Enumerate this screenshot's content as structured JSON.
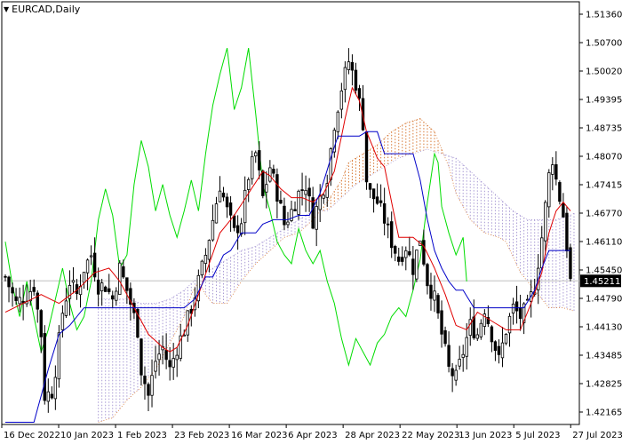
{
  "title": {
    "symbol_timeframe": "EURCAD,Daily",
    "icon": "dropdown-triangle-icon"
  },
  "colors": {
    "background": "#ffffff",
    "axis": "#000000",
    "grid_line": "#c0c0c0",
    "tenkan": "#e00000",
    "kijun": "#0000c8",
    "chikou": "#00dd00",
    "senkou_a_cloud": "#d2691e",
    "senkou_b_cloud": "#a090d0",
    "candle_bull": "#000000",
    "candle_bear": "#000000",
    "price_tag_bg": "#000000",
    "price_tag_text": "#ffffff"
  },
  "chart_data": {
    "type": "candlestick",
    "indicator": "Ichimoku Kinko Hyo",
    "symbol": "EURCAD",
    "timeframe": "Daily",
    "ylim": [
      1.4195,
      1.5155
    ],
    "y_ticks": [
      "1.51360",
      "1.50700",
      "1.50020",
      "1.49395",
      "1.48735",
      "1.48070",
      "1.47415",
      "1.46770",
      "1.46110",
      "1.45450",
      "1.44790",
      "1.44130",
      "1.43485",
      "1.42825",
      "1.42165"
    ],
    "x_tick_labels": [
      "16 Dec 2022",
      "10 Jan 2023",
      "1 Feb 2023",
      "23 Feb 2023",
      "16 Mar 2023",
      "6 Apr 2023",
      "28 Apr 2023",
      "22 May 2023",
      "13 Jun 2023",
      "5 Jul 2023",
      "27 Jul 2023"
    ],
    "current_price": "1.45211",
    "current_price_value": 1.45211,
    "close_keys": [
      [
        0,
        1.453
      ],
      [
        3,
        1.447
      ],
      [
        6,
        1.449
      ],
      [
        8,
        1.451
      ],
      [
        10,
        1.44
      ],
      [
        11,
        1.426
      ],
      [
        13,
        1.427
      ],
      [
        14,
        1.432
      ],
      [
        16,
        1.445
      ],
      [
        18,
        1.452
      ],
      [
        20,
        1.449
      ],
      [
        22,
        1.455
      ],
      [
        24,
        1.458
      ],
      [
        26,
        1.451
      ],
      [
        28,
        1.451
      ],
      [
        30,
        1.448
      ],
      [
        32,
        1.455
      ],
      [
        34,
        1.45
      ],
      [
        36,
        1.444
      ],
      [
        37,
        1.441
      ],
      [
        38,
        1.432
      ],
      [
        40,
        1.426
      ],
      [
        42,
        1.434
      ],
      [
        44,
        1.437
      ],
      [
        46,
        1.432
      ],
      [
        48,
        1.437
      ],
      [
        50,
        1.441
      ],
      [
        52,
        1.446
      ],
      [
        54,
        1.452
      ],
      [
        56,
        1.458
      ],
      [
        58,
        1.466
      ],
      [
        60,
        1.474
      ],
      [
        62,
        1.468
      ],
      [
        64,
        1.463
      ],
      [
        66,
        1.466
      ],
      [
        68,
        1.476
      ],
      [
        70,
        1.481
      ],
      [
        71,
        1.476
      ],
      [
        72,
        1.471
      ],
      [
        74,
        1.478
      ],
      [
        76,
        1.472
      ],
      [
        78,
        1.465
      ],
      [
        80,
        1.468
      ],
      [
        82,
        1.472
      ],
      [
        84,
        1.474
      ],
      [
        86,
        1.466
      ],
      [
        88,
        1.471
      ],
      [
        90,
        1.476
      ],
      [
        92,
        1.488
      ],
      [
        94,
        1.496
      ],
      [
        96,
        1.502
      ],
      [
        98,
        1.497
      ],
      [
        100,
        1.488
      ],
      [
        101,
        1.475
      ],
      [
        102,
        1.472
      ],
      [
        104,
        1.47
      ],
      [
        106,
        1.466
      ],
      [
        108,
        1.461
      ],
      [
        110,
        1.457
      ],
      [
        112,
        1.46
      ],
      [
        114,
        1.455
      ],
      [
        116,
        1.462
      ],
      [
        118,
        1.452
      ],
      [
        120,
        1.448
      ],
      [
        122,
        1.44
      ],
      [
        124,
        1.432
      ],
      [
        126,
        1.43
      ],
      [
        128,
        1.436
      ],
      [
        130,
        1.442
      ],
      [
        132,
        1.44
      ],
      [
        134,
        1.446
      ],
      [
        136,
        1.44
      ],
      [
        138,
        1.434
      ],
      [
        140,
        1.441
      ],
      [
        142,
        1.446
      ],
      [
        144,
        1.444
      ],
      [
        146,
        1.446
      ],
      [
        148,
        1.451
      ],
      [
        150,
        1.462
      ],
      [
        152,
        1.476
      ],
      [
        153,
        1.48
      ],
      [
        154,
        1.475
      ],
      [
        156,
        1.467
      ],
      [
        157,
        1.46
      ],
      [
        158,
        1.452
      ]
    ],
    "tenkan_keys": [
      [
        0,
        1.445
      ],
      [
        5,
        1.447
      ],
      [
        10,
        1.449
      ],
      [
        15,
        1.447
      ],
      [
        20,
        1.45
      ],
      [
        25,
        1.454
      ],
      [
        29,
        1.455
      ],
      [
        32,
        1.452
      ],
      [
        36,
        1.446
      ],
      [
        40,
        1.44
      ],
      [
        44,
        1.437
      ],
      [
        46,
        1.436
      ],
      [
        48,
        1.437
      ],
      [
        51,
        1.442
      ],
      [
        54,
        1.449
      ],
      [
        57,
        1.456
      ],
      [
        60,
        1.463
      ],
      [
        64,
        1.467
      ],
      [
        68,
        1.472
      ],
      [
        72,
        1.477
      ],
      [
        74,
        1.476
      ],
      [
        77,
        1.473
      ],
      [
        80,
        1.471
      ],
      [
        83,
        1.471
      ],
      [
        86,
        1.47
      ],
      [
        89,
        1.472
      ],
      [
        92,
        1.477
      ],
      [
        95,
        1.489
      ],
      [
        97,
        1.496
      ],
      [
        99,
        1.493
      ],
      [
        101,
        1.486
      ],
      [
        104,
        1.48
      ],
      [
        106,
        1.478
      ],
      [
        108,
        1.47
      ],
      [
        110,
        1.462
      ],
      [
        114,
        1.462
      ],
      [
        117,
        1.46
      ],
      [
        120,
        1.455
      ],
      [
        123,
        1.449
      ],
      [
        126,
        1.442
      ],
      [
        129,
        1.441
      ],
      [
        132,
        1.445
      ],
      [
        136,
        1.443
      ],
      [
        140,
        1.441
      ],
      [
        144,
        1.441
      ],
      [
        147,
        1.447
      ],
      [
        150,
        1.454
      ],
      [
        152,
        1.463
      ],
      [
        154,
        1.468
      ],
      [
        156,
        1.47
      ],
      [
        158,
        1.468
      ]
    ],
    "kijun_keys": [
      [
        0,
        1.42
      ],
      [
        5,
        1.42
      ],
      [
        8,
        1.42
      ],
      [
        12,
        1.432
      ],
      [
        15,
        1.44
      ],
      [
        18,
        1.442
      ],
      [
        22,
        1.446
      ],
      [
        24,
        1.446
      ],
      [
        27,
        1.446
      ],
      [
        32,
        1.446
      ],
      [
        36,
        1.446
      ],
      [
        40,
        1.446
      ],
      [
        44,
        1.446
      ],
      [
        47,
        1.446
      ],
      [
        50,
        1.446
      ],
      [
        53,
        1.448
      ],
      [
        56,
        1.453
      ],
      [
        58,
        1.453
      ],
      [
        61,
        1.458
      ],
      [
        63,
        1.459
      ],
      [
        66,
        1.463
      ],
      [
        68,
        1.463
      ],
      [
        70,
        1.463
      ],
      [
        72,
        1.465
      ],
      [
        75,
        1.466
      ],
      [
        79,
        1.466
      ],
      [
        82,
        1.467
      ],
      [
        85,
        1.467
      ],
      [
        88,
        1.472
      ],
      [
        91,
        1.48
      ],
      [
        93,
        1.485
      ],
      [
        96,
        1.485
      ],
      [
        99,
        1.485
      ],
      [
        101,
        1.486
      ],
      [
        104,
        1.486
      ],
      [
        106,
        1.481
      ],
      [
        109,
        1.481
      ],
      [
        112,
        1.481
      ],
      [
        114,
        1.481
      ],
      [
        116,
        1.475
      ],
      [
        118,
        1.466
      ],
      [
        120,
        1.459
      ],
      [
        122,
        1.455
      ],
      [
        124,
        1.452
      ],
      [
        126,
        1.45
      ],
      [
        128,
        1.45
      ],
      [
        131,
        1.446
      ],
      [
        135,
        1.446
      ],
      [
        140,
        1.446
      ],
      [
        145,
        1.446
      ],
      [
        148,
        1.45
      ],
      [
        150,
        1.455
      ],
      [
        152,
        1.459
      ],
      [
        158,
        1.459
      ]
    ],
    "chikou_keys": [
      [
        0,
        1.461
      ],
      [
        2,
        1.451
      ],
      [
        4,
        1.444
      ],
      [
        6,
        1.452
      ],
      [
        8,
        1.444
      ],
      [
        10,
        1.436
      ],
      [
        12,
        1.441
      ],
      [
        14,
        1.448
      ],
      [
        16,
        1.455
      ],
      [
        18,
        1.447
      ],
      [
        20,
        1.441
      ],
      [
        22,
        1.444
      ],
      [
        24,
        1.452
      ],
      [
        26,
        1.466
      ],
      [
        28,
        1.473
      ],
      [
        30,
        1.467
      ],
      [
        32,
        1.455
      ],
      [
        34,
        1.458
      ],
      [
        36,
        1.474
      ],
      [
        38,
        1.484
      ],
      [
        40,
        1.478
      ],
      [
        42,
        1.468
      ],
      [
        44,
        1.474
      ],
      [
        46,
        1.467
      ],
      [
        48,
        1.462
      ],
      [
        50,
        1.468
      ],
      [
        52,
        1.475
      ],
      [
        54,
        1.468
      ],
      [
        56,
        1.481
      ],
      [
        58,
        1.492
      ],
      [
        60,
        1.499
      ],
      [
        62,
        1.505
      ],
      [
        64,
        1.491
      ],
      [
        66,
        1.496
      ],
      [
        68,
        1.505
      ],
      [
        70,
        1.49
      ],
      [
        72,
        1.474
      ],
      [
        74,
        1.468
      ],
      [
        76,
        1.461
      ],
      [
        78,
        1.458
      ],
      [
        80,
        1.456
      ],
      [
        82,
        1.464
      ],
      [
        84,
        1.459
      ],
      [
        86,
        1.456
      ],
      [
        88,
        1.459
      ],
      [
        90,
        1.452
      ],
      [
        92,
        1.447
      ],
      [
        94,
        1.439
      ],
      [
        96,
        1.433
      ],
      [
        98,
        1.439
      ],
      [
        100,
        1.436
      ],
      [
        102,
        1.433
      ],
      [
        104,
        1.438
      ],
      [
        106,
        1.44
      ],
      [
        108,
        1.444
      ],
      [
        110,
        1.446
      ],
      [
        112,
        1.444
      ],
      [
        114,
        1.45
      ],
      [
        116,
        1.457
      ],
      [
        118,
        1.47
      ],
      [
        120,
        1.481
      ],
      [
        121,
        1.479
      ],
      [
        122,
        1.469
      ],
      [
        124,
        1.463
      ],
      [
        126,
        1.458
      ],
      [
        128,
        1.462
      ],
      [
        129,
        1.452
      ]
    ],
    "senkou_a_keys": [
      [
        26,
        1.42
      ],
      [
        30,
        1.421
      ],
      [
        34,
        1.425
      ],
      [
        38,
        1.428
      ],
      [
        42,
        1.432
      ],
      [
        46,
        1.438
      ],
      [
        48,
        1.441
      ],
      [
        50,
        1.444
      ],
      [
        52,
        1.449
      ],
      [
        54,
        1.452
      ],
      [
        56,
        1.449
      ],
      [
        58,
        1.447
      ],
      [
        62,
        1.447
      ],
      [
        66,
        1.452
      ],
      [
        70,
        1.456
      ],
      [
        74,
        1.459
      ],
      [
        78,
        1.462
      ],
      [
        82,
        1.463
      ],
      [
        86,
        1.466
      ],
      [
        90,
        1.47
      ],
      [
        94,
        1.475
      ],
      [
        96,
        1.479
      ],
      [
        100,
        1.481
      ],
      [
        104,
        1.483
      ],
      [
        108,
        1.486
      ],
      [
        112,
        1.488
      ],
      [
        116,
        1.489
      ],
      [
        120,
        1.486
      ],
      [
        124,
        1.478
      ],
      [
        126,
        1.472
      ],
      [
        130,
        1.466
      ],
      [
        134,
        1.463
      ],
      [
        138,
        1.462
      ],
      [
        140,
        1.461
      ],
      [
        144,
        1.454
      ],
      [
        148,
        1.45
      ],
      [
        152,
        1.446
      ],
      [
        156,
        1.446
      ],
      [
        160,
        1.445
      ]
    ],
    "senkou_b_keys": [
      [
        26,
        1.448
      ],
      [
        30,
        1.448
      ],
      [
        34,
        1.448
      ],
      [
        38,
        1.447
      ],
      [
        42,
        1.447
      ],
      [
        46,
        1.448
      ],
      [
        50,
        1.45
      ],
      [
        54,
        1.453
      ],
      [
        58,
        1.455
      ],
      [
        62,
        1.457
      ],
      [
        66,
        1.459
      ],
      [
        70,
        1.46
      ],
      [
        74,
        1.462
      ],
      [
        78,
        1.464
      ],
      [
        82,
        1.466
      ],
      [
        86,
        1.468
      ],
      [
        90,
        1.468
      ],
      [
        94,
        1.471
      ],
      [
        98,
        1.474
      ],
      [
        102,
        1.476
      ],
      [
        106,
        1.478
      ],
      [
        110,
        1.48
      ],
      [
        114,
        1.481
      ],
      [
        118,
        1.482
      ],
      [
        122,
        1.481
      ],
      [
        126,
        1.48
      ],
      [
        130,
        1.477
      ],
      [
        134,
        1.474
      ],
      [
        138,
        1.471
      ],
      [
        142,
        1.468
      ],
      [
        146,
        1.466
      ],
      [
        150,
        1.466
      ],
      [
        154,
        1.466
      ],
      [
        158,
        1.467
      ],
      [
        160,
        1.468
      ]
    ]
  }
}
